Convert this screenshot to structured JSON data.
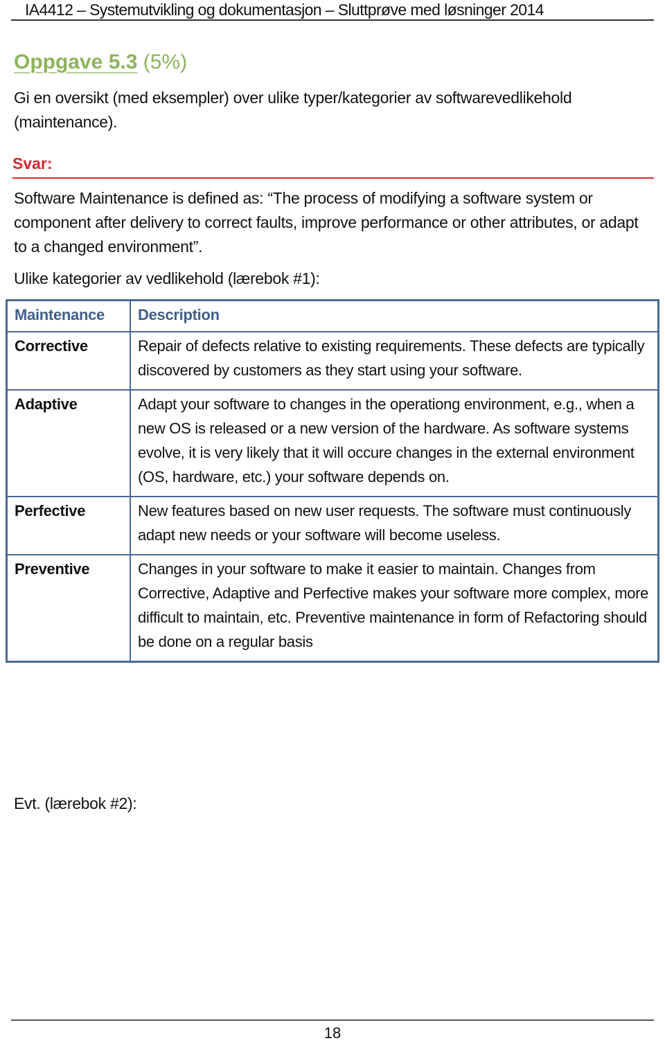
{
  "header": {
    "title": "IA4412 – Systemutvikling og dokumentasjon – Sluttprøve med løsninger 2014"
  },
  "task": {
    "number": "Oppgave 5.3",
    "weight": "(5%)",
    "question": "Gi en oversikt (med eksempler) over ulike typer/kategorier av softwarevedlikehold (maintenance)."
  },
  "answer": {
    "label": "Svar:",
    "definition": "Software Maintenance is defined as: “The process of modifying a software system or component after delivery to correct faults, improve performance or other attributes, or adapt to a changed environment”.",
    "categories_intro": "Ulike kategorier av vedlikehold (lærebok #1):",
    "table": {
      "headers": [
        "Maintenance",
        "Description"
      ],
      "rows": [
        {
          "category": "Corrective",
          "description": "Repair of defects relative to existing requirements. These defects are typically discovered by customers as they start using your software."
        },
        {
          "category": "Adaptive",
          "description": "Adapt your software to changes in the operationg environment, e.g., when a new OS is released or a new version of the hardware. As software systems evolve, it is very likely that it will occure changes in the external environment (OS, hardware, etc.) your software depends on."
        },
        {
          "category": "Perfective",
          "description": "New features based on new user requests. The software must continuously adapt new needs or your software will become useless."
        },
        {
          "category": "Preventive",
          "description": "Changes in your software to make it easier to maintain. Changes from Corrective, Adaptive and Perfective makes your software more complex, more difficult to maintain, etc. Preventive maintenance in form of Refactoring should be done on a regular basis"
        }
      ]
    },
    "evt": "Evt. (lærebok #2):"
  },
  "footer": {
    "page_number": "18"
  },
  "colors": {
    "task_title": "#8db35a",
    "answer_label": "#d9262c",
    "table_border": "#4a6a96",
    "table_header_text": "#3f5f8a"
  }
}
